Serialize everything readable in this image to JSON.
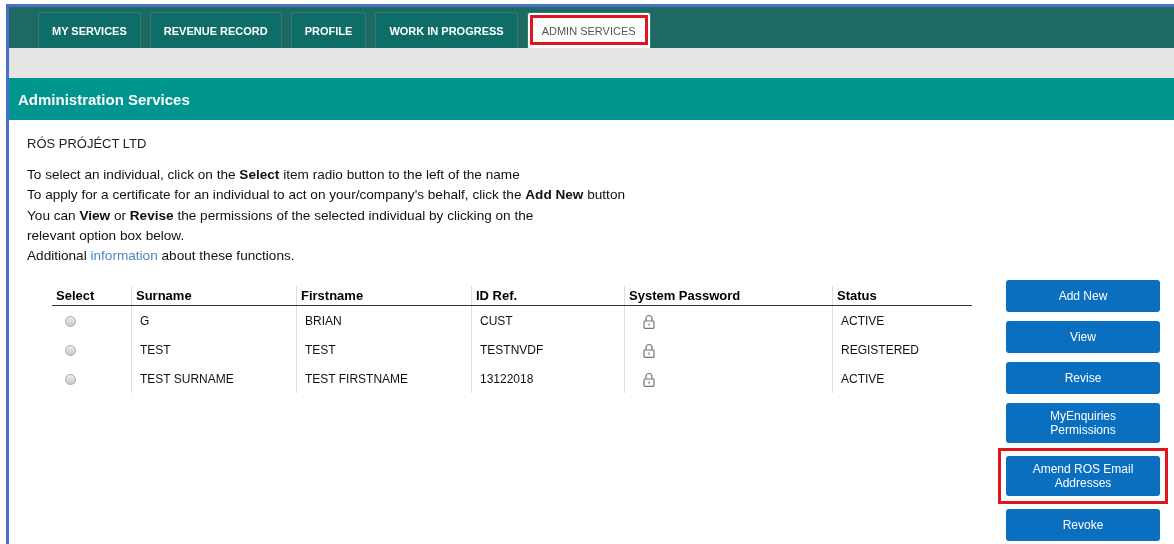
{
  "tabs": [
    {
      "label": "MY SERVICES",
      "selected": false,
      "highlighted": false
    },
    {
      "label": "REVENUE RECORD",
      "selected": false,
      "highlighted": false
    },
    {
      "label": "PROFILE",
      "selected": false,
      "highlighted": false
    },
    {
      "label": "WORK IN PROGRESS",
      "selected": false,
      "highlighted": false
    },
    {
      "label": "ADMIN SERVICES",
      "selected": true,
      "highlighted": true
    }
  ],
  "section_title": "Administration Services",
  "company": "RÓS PRÓJÉCT LTD",
  "instructions": [
    "To select an individual, click on the **Select** item radio button to the left of the name",
    "To apply for a certificate for an individual to act on your/company's behalf, click the **Add New** button",
    "You can **View** or **Revise** the permissions of the selected individual by clicking on the",
    "relevant option box below."
  ],
  "info_line": {
    "before": "Additional",
    "link": "information",
    "after": "about these functions."
  },
  "table": {
    "columns": [
      "Select",
      "Surname",
      "Firstname",
      "ID Ref.",
      "System Password",
      "Status"
    ],
    "rows": [
      {
        "selected": false,
        "surname": "G",
        "firstname": "BRIAN",
        "id_ref": "CUST",
        "status": "ACTIVE"
      },
      {
        "selected": false,
        "surname": "TEST",
        "firstname": "TEST",
        "id_ref": "TESTNVDF",
        "status": "REGISTERED"
      },
      {
        "selected": false,
        "surname": "TEST SURNAME",
        "firstname": "TEST FIRSTNAME",
        "id_ref": "13122018",
        "status": "ACTIVE"
      }
    ]
  },
  "buttons": [
    {
      "label": "Add New",
      "highlighted": false
    },
    {
      "label": "View",
      "highlighted": false
    },
    {
      "label": "Revise",
      "highlighted": false
    },
    {
      "label": "MyEnquiries Permissions",
      "highlighted": false
    },
    {
      "label": "Amend ROS Email Addresses",
      "highlighted": true
    },
    {
      "label": "Revoke",
      "highlighted": false
    }
  ]
}
